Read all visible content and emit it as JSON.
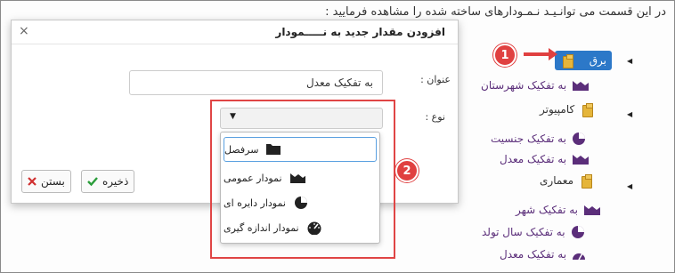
{
  "intro_text": "در این قسمت می توانـیـد نـمـودارهای ساخته شده را مشاهده فرمایید :",
  "tree": {
    "selected_node": "برق",
    "items": [
      {
        "label": "به تفکیک شهرستان",
        "icon": "area-chart-icon"
      },
      {
        "label": "کامپیوتر",
        "icon": "folder-icon"
      },
      {
        "label": "به تفکیک جنسیت",
        "icon": "pie-chart-icon"
      },
      {
        "label": "به تفکیک معدل",
        "icon": "area-chart-icon"
      },
      {
        "label": "معماری",
        "icon": "folder-icon"
      },
      {
        "label": "به تفکیک شهر",
        "icon": "area-chart-icon"
      },
      {
        "label": "به تفکیک سال تولد",
        "icon": "pie-chart-icon"
      },
      {
        "label": "به تفکیک معدل",
        "icon": "gauge-chart-icon"
      }
    ]
  },
  "dialog": {
    "title": "افزودن مقدار جدید به نـــــمودار",
    "close": "×",
    "title_label": "عنوان :",
    "title_value": "به تفکیک معدل",
    "type_label": "نوع :",
    "options": [
      {
        "label": "سرفصل",
        "icon": "folder-dark-icon"
      },
      {
        "label": "نمودار عمومی",
        "icon": "area-chart-icon"
      },
      {
        "label": "نمودار دایره ای",
        "icon": "pie-chart-icon"
      },
      {
        "label": "نمودار اندازه گیری",
        "icon": "gauge-icon"
      }
    ],
    "save_label": "ذخیره",
    "close_label": "بستن"
  },
  "callouts": [
    "1",
    "2"
  ],
  "colors": {
    "accent": "#2c78c8",
    "highlight": "#e04040",
    "icon_purple": "#5b2e7a"
  }
}
